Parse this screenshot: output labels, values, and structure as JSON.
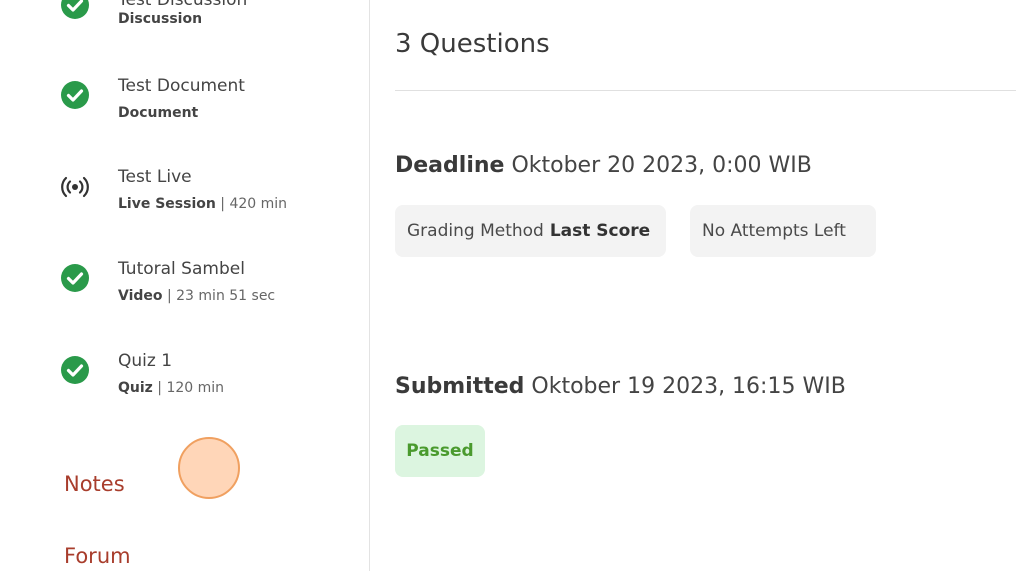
{
  "sidebar": {
    "lessons": [
      {
        "title": "Test Discussion",
        "type": "Discussion",
        "detail": ""
      },
      {
        "title": "Test Document",
        "type": "Document",
        "detail": ""
      },
      {
        "title": "Test Live",
        "type": "Live Session",
        "detail": " | 420 min"
      },
      {
        "title": "Tutoral Sambel",
        "type": "Video",
        "detail": " | 23 min 51 sec"
      },
      {
        "title": "Quiz 1",
        "type": "Quiz",
        "detail": " | 120 min"
      }
    ],
    "nav": {
      "notes": "Notes",
      "forum": "Forum"
    }
  },
  "main": {
    "questions_count": "3 Questions",
    "deadline_label": "Deadline",
    "deadline_value": " Oktober 20 2023, 0:00 WIB",
    "grading_label": "Grading Method",
    "grading_value": "Last Score",
    "attempts": "No Attempts Left",
    "submitted_label": "Submitted",
    "submitted_value": " Oktober 19 2023, 16:15 WIB",
    "status": "Passed"
  },
  "colors": {
    "check_green": "#2a9a4a",
    "link_red": "#a83d2c",
    "passed_bg": "#dcf5e0",
    "passed_text": "#4a9a2e",
    "chip_bg": "#f3f3f3"
  },
  "icons": {
    "completed": "check-circle-icon",
    "live": "broadcast-icon"
  }
}
